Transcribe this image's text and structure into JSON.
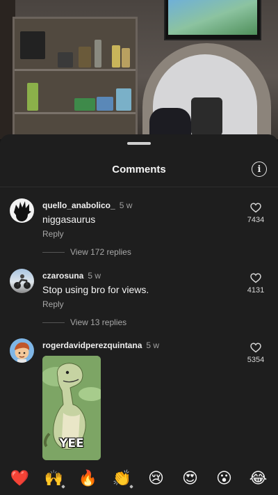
{
  "sheet": {
    "title": "Comments",
    "info_icon": "info-icon",
    "info_glyph": "i"
  },
  "comments": [
    {
      "username": "quello_anabolico_",
      "time": "5 w",
      "text": "niggasaurus",
      "reply_label": "Reply",
      "view_replies": "View 172 replies",
      "likes": "7434",
      "avatar_icon": "goku-silhouette-avatar"
    },
    {
      "username": "czarosuna",
      "time": "5 w",
      "text": "Stop using bro for views.",
      "reply_label": "Reply",
      "view_replies": "View 13 replies",
      "likes": "4131",
      "avatar_icon": "motorcycle-photo-avatar"
    },
    {
      "username": "rogerdavidperezquintana",
      "time": "5 w",
      "gif_caption": "YEE",
      "likes": "5354",
      "avatar_icon": "cartoon-boy-avatar"
    }
  ],
  "emoji_bar": [
    {
      "name": "heart",
      "glyph": "❤️",
      "has_tone": false
    },
    {
      "name": "raising-hands",
      "glyph": "🙌",
      "has_tone": true
    },
    {
      "name": "fire",
      "glyph": "🔥",
      "has_tone": false
    },
    {
      "name": "clapping-hands",
      "glyph": "👏",
      "has_tone": true
    },
    {
      "name": "crying-face",
      "glyph": "😢",
      "has_tone": false
    },
    {
      "name": "heart-eyes",
      "glyph": "😍",
      "has_tone": false
    },
    {
      "name": "astonished-face",
      "glyph": "😮",
      "has_tone": false
    },
    {
      "name": "tears-of-joy",
      "glyph": "😂",
      "has_tone": false
    }
  ],
  "colors": {
    "sheet_bg": "#1e1e1e",
    "secondary_text": "#a8a8a8",
    "primary_text": "#f4f4f4"
  }
}
